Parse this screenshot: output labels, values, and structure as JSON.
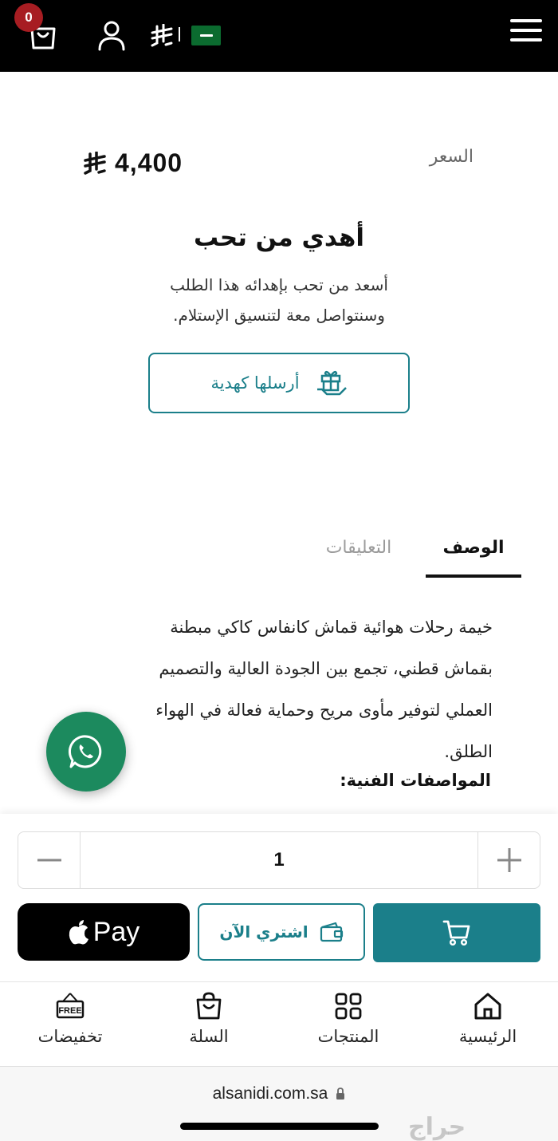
{
  "header": {
    "cart_count": "0",
    "country_flag": "saudi-arabia",
    "colors": {
      "background": "#000000",
      "badge": "#a71d22"
    }
  },
  "product": {
    "price_label": "السعر",
    "price_value": "4,400",
    "currency_icon": "saudi-riyal-icon"
  },
  "gift": {
    "title": "أهدي من تحب",
    "description_line1": "أسعد من تحب بإهدائه هذا الطلب",
    "description_line2": "وسنتواصل معة لتنسيق الإستلام.",
    "button_label": "أرسلها كهدية"
  },
  "tabs": {
    "description": "الوصف",
    "comments": "التعليقات",
    "active": "description"
  },
  "description": {
    "line1": "خيمة رحلات هوائية قماش كانفاس كاكي مبطنة",
    "line2": "بقماش قطني، تجمع بين الجودة العالية والتصميم",
    "line3": "العملي لتوفير مأوى مريح وحماية فعالة في الهواء",
    "line4": "الطلق.",
    "specs_heading": "المواصفات الفنية:"
  },
  "purchase": {
    "quantity": "1",
    "apple_pay_label": "Pay",
    "buy_now_label": "اشتري الآن",
    "accent_color": "#1b7f8a"
  },
  "bottom_nav": {
    "home": "الرئيسية",
    "products": "المنتجات",
    "cart": "السلة",
    "sales": "تخفيضات",
    "sale_icon_text": "FREE"
  },
  "browser": {
    "url": "alsanidi.com.sa",
    "watermark": "حراج"
  }
}
